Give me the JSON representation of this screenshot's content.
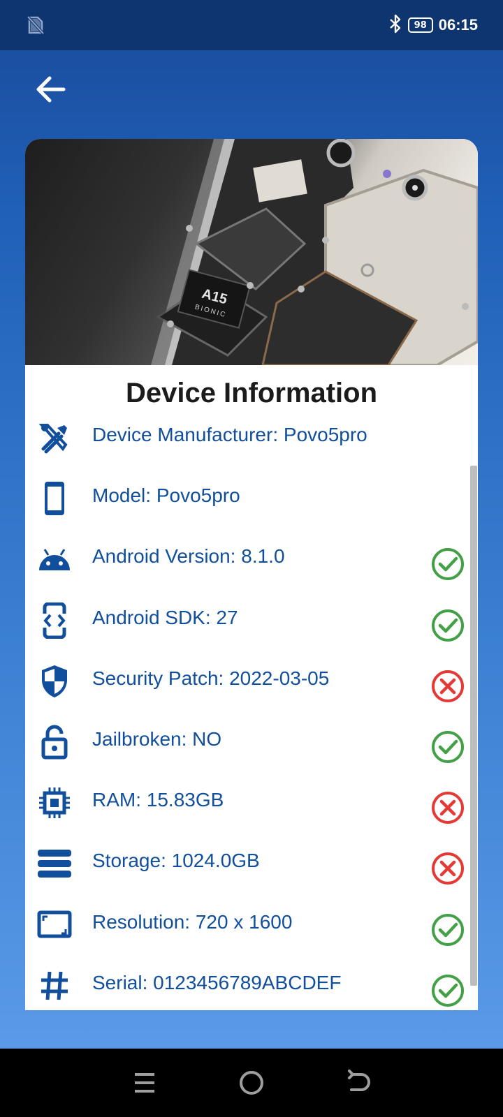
{
  "status_bar": {
    "battery_level": "98",
    "time": "06:15",
    "icons": [
      "no-sim-icon",
      "bluetooth-icon",
      "battery-icon"
    ]
  },
  "header": {
    "back_icon": "arrow-back-icon"
  },
  "card": {
    "hero_chip_text": [
      "A15",
      "BIONIC"
    ],
    "title": "Device Information",
    "items": [
      {
        "label": "Device Manufacturer: Povo5pro",
        "icon": "tools-icon",
        "status": null
      },
      {
        "label": "Model: Povo5pro",
        "icon": "smartphone-icon",
        "status": null
      },
      {
        "label": "Android Version: 8.1.0",
        "icon": "android-icon",
        "status": "ok"
      },
      {
        "label": "Android SDK: 27",
        "icon": "developer-mode-icon",
        "status": "ok"
      },
      {
        "label": "Security Patch: 2022-03-05",
        "icon": "shield-icon",
        "status": "fail"
      },
      {
        "label": "Jailbroken: NO",
        "icon": "lock-open-icon",
        "status": "ok"
      },
      {
        "label": "RAM: 15.83GB",
        "icon": "memory-chip-icon",
        "status": "fail"
      },
      {
        "label": "Storage: 1024.0GB",
        "icon": "storage-icon",
        "status": "fail"
      },
      {
        "label": "Resolution: 720 x 1600",
        "icon": "screen-icon",
        "status": "ok"
      },
      {
        "label": "Serial: 0123456789ABCDEF",
        "icon": "hash-icon",
        "status": "ok"
      }
    ]
  },
  "colors": {
    "accent_blue": "#114f9c",
    "ok_green": "#43a047",
    "fail_red": "#e53935"
  },
  "nav_bar": {
    "buttons": [
      "recents-icon",
      "home-icon",
      "back-nav-icon"
    ]
  }
}
